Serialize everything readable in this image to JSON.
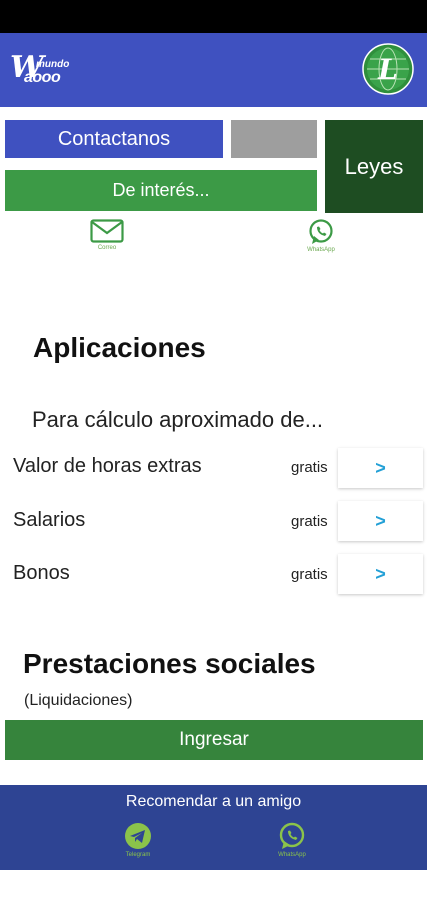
{
  "header": {
    "logo": {
      "w": "W",
      "mundo": "mundo",
      "waooo": "aooo"
    },
    "leyes_logo_letter": "L"
  },
  "buttons": {
    "contactanos": "Contactanos",
    "leyes": "Leyes",
    "de_interes": "De interés..."
  },
  "quick_icons": {
    "correo": {
      "icon": "mail-icon",
      "caption": "Correo"
    },
    "whatsapp": {
      "icon": "whatsapp-icon",
      "caption": "WhatsApp"
    }
  },
  "aplicaciones": {
    "title": "Aplicaciones",
    "subtitle": "Para cálculo aproximado de...",
    "items": [
      {
        "label": "Valor de horas extras",
        "badge": "gratis",
        "action": ">"
      },
      {
        "label": "Salarios",
        "badge": "gratis",
        "action": ">"
      },
      {
        "label": "Bonos",
        "badge": "gratis",
        "action": ">"
      }
    ]
  },
  "prestaciones": {
    "title": "Prestaciones sociales",
    "subtitle": "(Liquidaciones)",
    "button": "Ingresar"
  },
  "footer": {
    "recommend": "Recomendar a un amigo",
    "telegram": {
      "icon": "telegram-icon",
      "caption": "Telegram"
    },
    "whatsapp": {
      "icon": "whatsapp-icon",
      "caption": "WhatsApp"
    }
  },
  "colors": {
    "brand_blue": "#3f51c0",
    "green": "#3c9a46",
    "dark_green": "#1e4d22",
    "footer_blue": "#2e4493",
    "link_blue": "#23a0d6"
  }
}
